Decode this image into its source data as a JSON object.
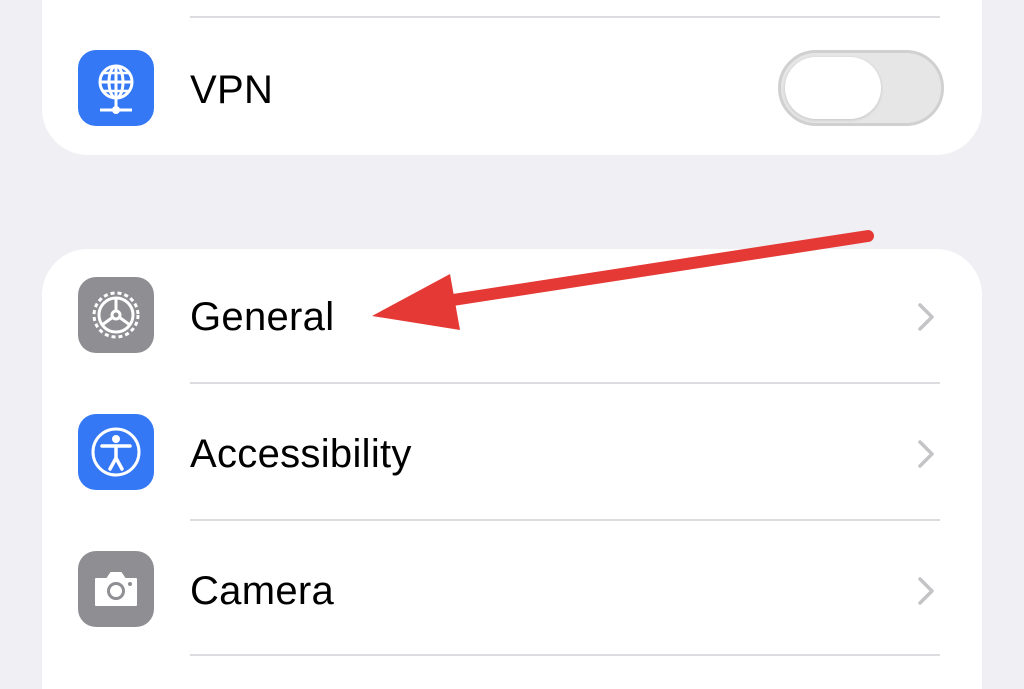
{
  "settings": {
    "group1": {
      "vpn": {
        "label": "VPN",
        "icon": "vpn-globe-icon",
        "toggle_on": false,
        "icon_color": "#3478f6"
      }
    },
    "group2": {
      "items": [
        {
          "label": "General",
          "icon": "gear-icon",
          "icon_color": "#8e8e93"
        },
        {
          "label": "Accessibility",
          "icon": "accessibility-icon",
          "icon_color": "#3478f6"
        },
        {
          "label": "Camera",
          "icon": "camera-icon",
          "icon_color": "#8e8e93"
        }
      ]
    }
  },
  "annotation": {
    "arrow_color": "#e53935",
    "points_to": "General"
  }
}
